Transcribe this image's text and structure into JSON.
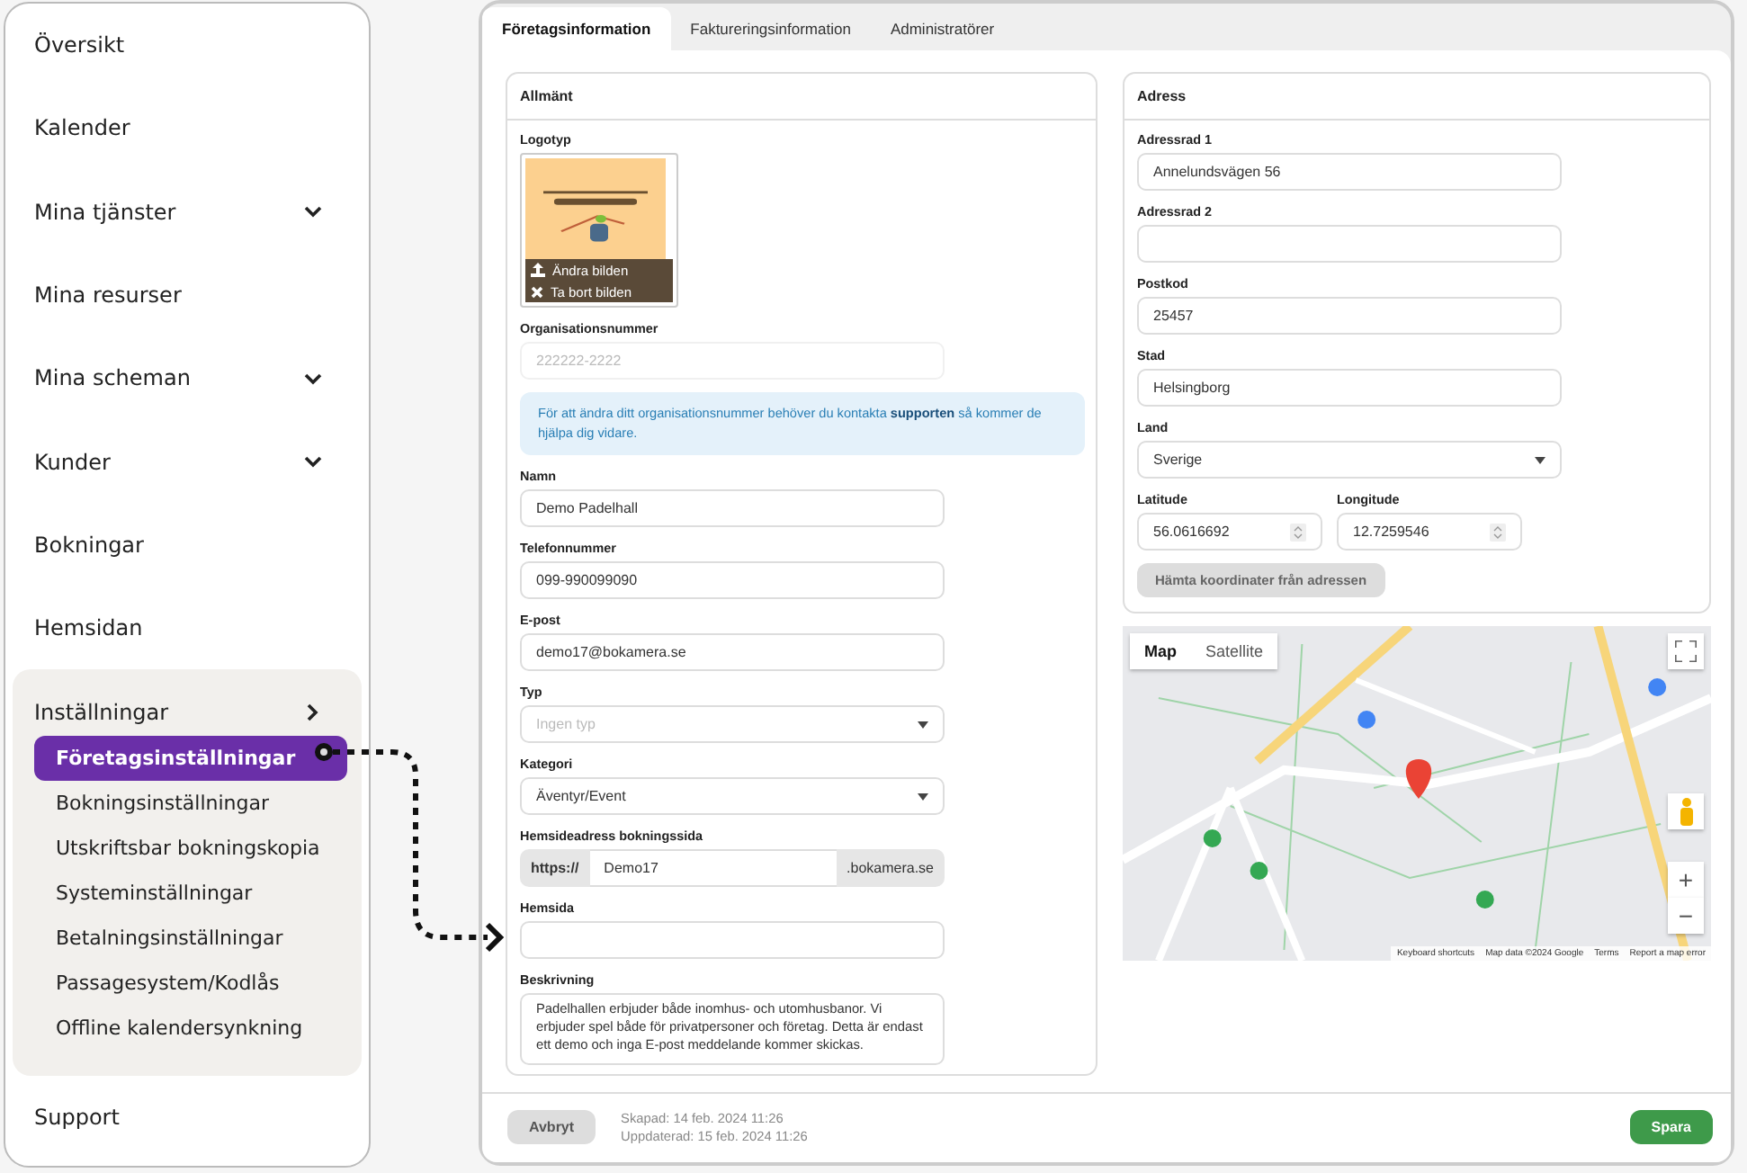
{
  "sidebar": {
    "items": [
      {
        "label": "Översikt"
      },
      {
        "label": "Kalender"
      },
      {
        "label": "Mina tjänster",
        "expanded": false
      },
      {
        "label": "Mina resurser"
      },
      {
        "label": "Mina scheman",
        "expanded": false
      },
      {
        "label": "Kunder",
        "expanded": false
      },
      {
        "label": "Bokningar"
      },
      {
        "label": "Hemsidan"
      },
      {
        "label": "Inställningar",
        "expanded": true,
        "children": [
          {
            "label": "Företagsinställningar",
            "selected": true
          },
          {
            "label": "Bokningsinställningar",
            "selected": false
          },
          {
            "label": "Utskriftsbar bokningskopia",
            "selected": false
          },
          {
            "label": "Systeminställningar",
            "selected": false
          },
          {
            "label": "Betalningsinställningar",
            "selected": false
          },
          {
            "label": "Passagesystem/Kodlås",
            "selected": false
          },
          {
            "label": "Offline kalendersynkning",
            "selected": false
          }
        ]
      },
      {
        "label": "Support"
      }
    ]
  },
  "tabs": [
    {
      "label": "Företagsinformation",
      "selected": true
    },
    {
      "label": "Faktureringsinformation",
      "selected": false
    },
    {
      "label": "Administratörer",
      "selected": false
    }
  ],
  "general": {
    "title": "Allmänt",
    "logo": {
      "label": "Logotyp",
      "kind": "picture",
      "actions": [
        "Ändra bilden",
        "Ta bort bilden"
      ]
    },
    "org_number": {
      "label": "Organisationsnummer",
      "placeholder": "222222-2222"
    },
    "notice": {
      "before": "För att ändra ditt organisationsnummer behöver du kontakta ",
      "link": "supporten",
      "after": " så kommer de hjälpa dig vidare."
    },
    "fields": [
      {
        "kind": "text",
        "label": "Namn",
        "value": "Demo Padelhall"
      },
      {
        "kind": "text",
        "label": "Telefonnummer",
        "value": "099-990099090"
      },
      {
        "kind": "text",
        "label": "E-post",
        "value": "demo17@bokamera.se"
      },
      {
        "kind": "select",
        "label": "Typ",
        "placeholder": "Ingen typ"
      },
      {
        "kind": "select",
        "label": "Kategori",
        "value": "Äventyr/Event"
      },
      {
        "kind": "prefixed",
        "label": "Hemsideadress bokningssida",
        "prefix": "https://",
        "value": "Demo17",
        "suffix": ".bokamera.se"
      },
      {
        "kind": "text",
        "label": "Hemsida"
      },
      {
        "kind": "textarea",
        "label": "Beskrivning",
        "value": "Padelhallen erbjuder både inomhus- och utomhusbanor. Vi erbjuder spel både för privatpersoner och företag. Detta är endast ett demo och inga E-post meddelande kommer skickas."
      }
    ]
  },
  "address": {
    "title": "Adress",
    "fields": [
      {
        "kind": "text",
        "label": "Adressrad 1",
        "value": "Annelundsvägen 56"
      },
      {
        "kind": "text",
        "label": "Adressrad 2"
      },
      {
        "kind": "text",
        "label": "Postkod",
        "value": "25457"
      },
      {
        "kind": "text",
        "label": "Stad",
        "value": "Helsingborg"
      },
      {
        "kind": "select",
        "label": "Land",
        "value": "Sverige"
      }
    ],
    "coordinates": [
      {
        "label": "Latitude",
        "value": "56.0616692"
      },
      {
        "label": "Longitude",
        "value": "12.7259546"
      }
    ],
    "button": "Hämta koordinater från adressen"
  },
  "map": {
    "kind": "picture",
    "map_types": [
      {
        "label": "Map",
        "selected": true
      },
      {
        "label": "Satellite",
        "selected": false
      }
    ],
    "zoom_in": "+",
    "zoom_out": "−",
    "attribution": [
      "Keyboard shortcuts",
      "Map data ©2024 Google",
      "Terms",
      "Report a map error"
    ]
  },
  "footer": {
    "cancel": "Avbryt",
    "created": "Skapad: 14 feb. 2024 11:26",
    "updated": "Uppdaterad: 15 feb. 2024 11:26",
    "save": "Spara"
  }
}
